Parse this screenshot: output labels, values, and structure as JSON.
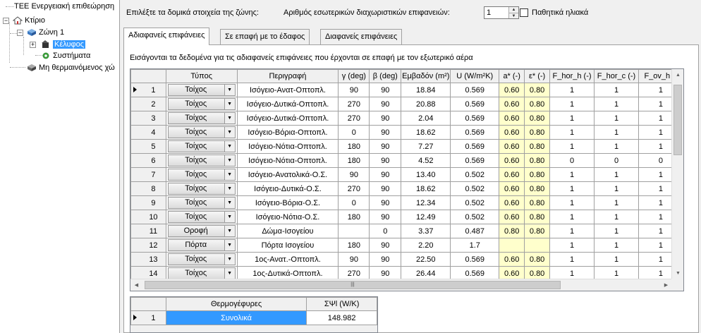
{
  "tree": {
    "root_label": "ΤΕΕ Ενεργειακή επιθεώρηση",
    "building_label": "Κτίριο",
    "zone_label": "Ζώνη 1",
    "envelope_label": "Κέλυφος",
    "systems_label": "Συστήματα",
    "unheated_label": "Μη θερμαινόμενος χώ"
  },
  "header": {
    "select_elements_label": "Επιλέξτε τα δομικά στοιχεία της ζώνης:",
    "internal_surfaces_label": "Αριθμός εσωτερικών διαχωριστικών επιφανειών:",
    "internal_surfaces_value": "1",
    "passive_solar_label": "Παθητικά ηλιακά"
  },
  "tabs": [
    {
      "label": "Αδιαφανείς επιφάνειες",
      "active": true
    },
    {
      "label": "Σε επαφή με το έδαφος",
      "active": false
    },
    {
      "label": "Διαφανείς επιφάνειες",
      "active": false
    }
  ],
  "grid_caption": "Εισάγονται τα δεδομένα για τις αδιαφανείς επιφάνειες που έρχονται σε επαφή με τον εξωτερικό αέρα",
  "grid": {
    "columns": [
      "Τύπος",
      "Περιγραφή",
      "γ (deg)",
      "β (deg)",
      "Εμβαδόν (m²)",
      "U (W/m²K)",
      "a* (-)",
      "ε* (-)",
      "F_hor_h (-)",
      "F_hor_c (-)",
      "F_ov_h (-"
    ],
    "rows": [
      {
        "n": "1",
        "type": "Τοίχος",
        "desc": "Ισόγειο-Ανατ-Οπτοπλ.",
        "g": "90",
        "b": "90",
        "area": "18.84",
        "u": "0.569",
        "a": "0.60",
        "e": "0.80",
        "fhh": "1",
        "fhc": "1",
        "fovh": "1"
      },
      {
        "n": "2",
        "type": "Τοίχος",
        "desc": "Ισόγειο-Δυτικά-Οπτοπλ.",
        "g": "270",
        "b": "90",
        "area": "20.88",
        "u": "0.569",
        "a": "0.60",
        "e": "0.80",
        "fhh": "1",
        "fhc": "1",
        "fovh": "1"
      },
      {
        "n": "3",
        "type": "Τοίχος",
        "desc": "Ισόγειο-Δυτικά-Οπτοπλ.",
        "g": "270",
        "b": "90",
        "area": "2.04",
        "u": "0.569",
        "a": "0.60",
        "e": "0.80",
        "fhh": "1",
        "fhc": "1",
        "fovh": "1"
      },
      {
        "n": "4",
        "type": "Τοίχος",
        "desc": "Ισόγειο-Βόρια-Οπτοπλ.",
        "g": "0",
        "b": "90",
        "area": "18.62",
        "u": "0.569",
        "a": "0.60",
        "e": "0.80",
        "fhh": "1",
        "fhc": "1",
        "fovh": "1"
      },
      {
        "n": "5",
        "type": "Τοίχος",
        "desc": "Ισόγειο-Νότια-Οπτοπλ.",
        "g": "180",
        "b": "90",
        "area": "7.27",
        "u": "0.569",
        "a": "0.60",
        "e": "0.80",
        "fhh": "1",
        "fhc": "1",
        "fovh": "1"
      },
      {
        "n": "6",
        "type": "Τοίχος",
        "desc": "Ισόγειο-Νότια-Οπτοπλ.",
        "g": "180",
        "b": "90",
        "area": "4.52",
        "u": "0.569",
        "a": "0.60",
        "e": "0.80",
        "fhh": "0",
        "fhc": "0",
        "fovh": "0"
      },
      {
        "n": "7",
        "type": "Τοίχος",
        "desc": "Ισόγειο-Ανατολικά-Ο.Σ.",
        "g": "90",
        "b": "90",
        "area": "13.40",
        "u": "0.502",
        "a": "0.60",
        "e": "0.80",
        "fhh": "1",
        "fhc": "1",
        "fovh": "1"
      },
      {
        "n": "8",
        "type": "Τοίχος",
        "desc": "Ισόγειο-Δυτικά-Ο.Σ.",
        "g": "270",
        "b": "90",
        "area": "18.62",
        "u": "0.502",
        "a": "0.60",
        "e": "0.80",
        "fhh": "1",
        "fhc": "1",
        "fovh": "1"
      },
      {
        "n": "9",
        "type": "Τοίχος",
        "desc": "Ισόγειο-Βόρια-Ο.Σ.",
        "g": "0",
        "b": "90",
        "area": "12.34",
        "u": "0.502",
        "a": "0.60",
        "e": "0.80",
        "fhh": "1",
        "fhc": "1",
        "fovh": "1"
      },
      {
        "n": "10",
        "type": "Τοίχος",
        "desc": "Ισόγειο-Νότια-Ο.Σ.",
        "g": "180",
        "b": "90",
        "area": "12.49",
        "u": "0.502",
        "a": "0.60",
        "e": "0.80",
        "fhh": "1",
        "fhc": "1",
        "fovh": "1"
      },
      {
        "n": "11",
        "type": "Οροφή",
        "desc": "Δώμα-Ισογείου",
        "g": "",
        "b": "0",
        "area": "3.37",
        "u": "0.487",
        "a": "0.80",
        "e": "0.80",
        "fhh": "1",
        "fhc": "1",
        "fovh": "1"
      },
      {
        "n": "12",
        "type": "Πόρτα",
        "desc": "Πόρτα Ισογείου",
        "g": "180",
        "b": "90",
        "area": "2.20",
        "u": "1.7",
        "a": "",
        "e": "",
        "fhh": "1",
        "fhc": "1",
        "fovh": "1"
      },
      {
        "n": "13",
        "type": "Τοίχος",
        "desc": "1ος-Ανατ.-Οπτοπλ.",
        "g": "90",
        "b": "90",
        "area": "22.50",
        "u": "0.569",
        "a": "0.60",
        "e": "0.80",
        "fhh": "1",
        "fhc": "1",
        "fovh": "1"
      },
      {
        "n": "14",
        "type": "Τοίχος",
        "desc": "1ος-Δυτικά-Οπτοπλ.",
        "g": "270",
        "b": "90",
        "area": "26.44",
        "u": "0.569",
        "a": "0.60",
        "e": "0.80",
        "fhh": "1",
        "fhc": "1",
        "fovh": "1"
      }
    ]
  },
  "thermal_bridges": {
    "columns": [
      "Θερμογέφυρες",
      "ΣΨl (W/K)"
    ],
    "row": {
      "n": "1",
      "label": "Συνολικά",
      "value": "148.982"
    }
  },
  "icons": {
    "tree_building": "house-icon",
    "tree_zone": "zone-cube-icon",
    "tree_envelope": "envelope-icon",
    "tree_systems": "systems-gear-icon",
    "tree_unheated": "unheated-cube-icon"
  },
  "colors": {
    "selection": "#3399ff",
    "highlight_cells": "#ffffcc"
  }
}
